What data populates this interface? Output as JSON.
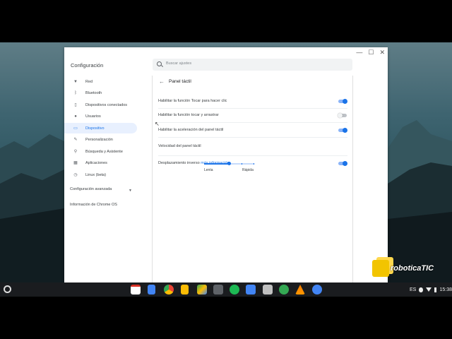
{
  "window": {
    "title": "Configuración",
    "controls": {
      "minimize": "—",
      "maximize": "☐",
      "close": "✕"
    }
  },
  "search": {
    "placeholder": "Buscar ajustes"
  },
  "sidebar": {
    "items": [
      {
        "label": "Red",
        "icon": "wifi-icon",
        "glyph": "▼"
      },
      {
        "label": "Bluetooth",
        "icon": "bluetooth-icon",
        "glyph": "ᛒ"
      },
      {
        "label": "Dispositivos conectados",
        "icon": "phone-icon",
        "glyph": "▯"
      },
      {
        "label": "Usuarios",
        "icon": "person-icon",
        "glyph": "●"
      },
      {
        "label": "Dispositivo",
        "icon": "laptop-icon",
        "glyph": "▭",
        "active": true
      },
      {
        "label": "Personalización",
        "icon": "brush-icon",
        "glyph": "✎"
      },
      {
        "label": "Búsqueda y Asistente",
        "icon": "search-icon",
        "glyph": "⚲"
      },
      {
        "label": "Aplicaciones",
        "icon": "apps-icon",
        "glyph": "▦"
      },
      {
        "label": "Linux (beta)",
        "icon": "clock-icon",
        "glyph": "◷"
      }
    ],
    "advanced": "Configuración avanzada",
    "about": "Información de Chrome OS"
  },
  "content": {
    "back_glyph": "←",
    "title": "Panel táctil",
    "rows": [
      {
        "label": "Habilitar la función Tocar para hacer clic",
        "toggle": true
      },
      {
        "label": "Habilitar la función tocar y arrastrar",
        "toggle": false
      },
      {
        "label": "Habilitar la aceleración del panel táctil",
        "toggle": true
      }
    ],
    "speed": {
      "label": "Velocidad del panel táctil",
      "slow": "Lenta",
      "fast": "Rápida",
      "value_fraction": 0.5
    },
    "reverse": {
      "label": "Desplazamiento inverso",
      "link": "más información",
      "toggle": true
    }
  },
  "tray": {
    "language": "ES",
    "time": "15:38"
  },
  "watermark": {
    "text": "roboticaTIC"
  },
  "colors": {
    "accent": "#1a73e8",
    "active_bg": "#e8f0fe"
  }
}
